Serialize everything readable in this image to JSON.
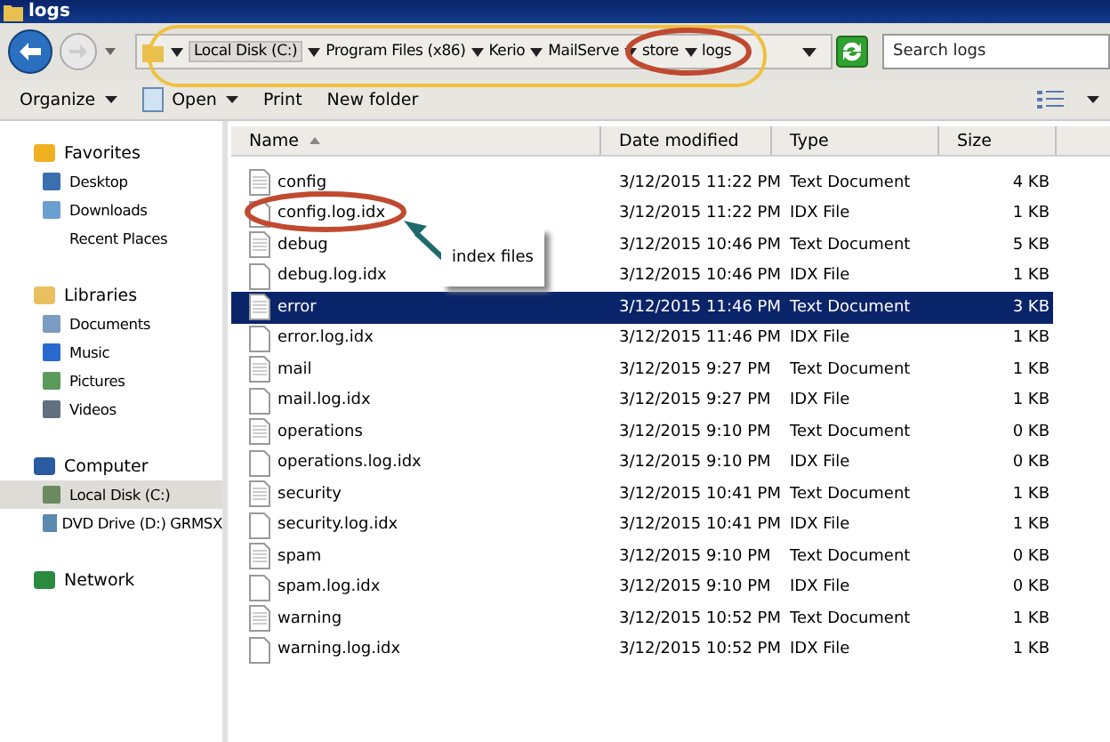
{
  "window": {
    "title": "logs"
  },
  "address": {
    "crumbs": [
      "Local Disk (C:)",
      "Program Files (x86)",
      "Kerio",
      "MailServe",
      "store",
      "logs"
    ]
  },
  "search": {
    "placeholder": "Search logs"
  },
  "toolbar": [
    {
      "label": "Organize",
      "kind": "menu"
    },
    {
      "label": "Open",
      "kind": "open"
    },
    {
      "label": "Print",
      "kind": "plain"
    },
    {
      "label": "New folder",
      "kind": "plain"
    }
  ],
  "sidebar": {
    "groups": [
      {
        "label": "Favorites",
        "items": [
          {
            "label": "Desktop",
            "selected": false
          },
          {
            "label": "Downloads",
            "selected": false
          },
          {
            "label": "Recent Places",
            "selected": false
          }
        ]
      },
      {
        "label": "Libraries",
        "items": [
          {
            "label": "Documents",
            "selected": false
          },
          {
            "label": "Music",
            "selected": false
          },
          {
            "label": "Pictures",
            "selected": false
          },
          {
            "label": "Videos",
            "selected": false
          }
        ]
      },
      {
        "label": "Computer",
        "items": [
          {
            "label": "Local Disk (C:)",
            "selected": true
          },
          {
            "label": "DVD Drive (D:) GRMSX",
            "selected": false
          }
        ]
      },
      {
        "label": "Network"
      }
    ]
  },
  "table": {
    "columns": [
      "Name",
      "Date modified",
      "Type",
      "Size"
    ],
    "rows": [
      {
        "name": "config",
        "date": "3/12/2015 11:22 PM",
        "type": "Text Document",
        "size": "4 KB",
        "kind": "text",
        "selected": false
      },
      {
        "name": "config.log.idx",
        "date": "3/12/2015 11:22 PM",
        "type": "IDX File",
        "size": "1 KB",
        "kind": "idx",
        "selected": false
      },
      {
        "name": "debug",
        "date": "3/12/2015 10:46 PM",
        "type": "Text Document",
        "size": "5 KB",
        "kind": "text",
        "selected": false
      },
      {
        "name": "debug.log.idx",
        "date": "3/12/2015 10:46 PM",
        "type": "IDX File",
        "size": "1 KB",
        "kind": "idx",
        "selected": false
      },
      {
        "name": "error",
        "date": "3/12/2015 11:46 PM",
        "type": "Text Document",
        "size": "3 KB",
        "kind": "text",
        "selected": true
      },
      {
        "name": "error.log.idx",
        "date": "3/12/2015 11:46 PM",
        "type": "IDX File",
        "size": "1 KB",
        "kind": "idx",
        "selected": false
      },
      {
        "name": "mail",
        "date": "3/12/2015 9:27 PM",
        "type": "Text Document",
        "size": "1 KB",
        "kind": "text",
        "selected": false
      },
      {
        "name": "mail.log.idx",
        "date": "3/12/2015 9:27 PM",
        "type": "IDX File",
        "size": "1 KB",
        "kind": "idx",
        "selected": false
      },
      {
        "name": "operations",
        "date": "3/12/2015 9:10 PM",
        "type": "Text Document",
        "size": "0 KB",
        "kind": "text",
        "selected": false
      },
      {
        "name": "operations.log.idx",
        "date": "3/12/2015 9:10 PM",
        "type": "IDX File",
        "size": "0 KB",
        "kind": "idx",
        "selected": false
      },
      {
        "name": "security",
        "date": "3/12/2015 10:41 PM",
        "type": "Text Document",
        "size": "1 KB",
        "kind": "text",
        "selected": false
      },
      {
        "name": "security.log.idx",
        "date": "3/12/2015 10:41 PM",
        "type": "IDX File",
        "size": "1 KB",
        "kind": "idx",
        "selected": false
      },
      {
        "name": "spam",
        "date": "3/12/2015 9:10 PM",
        "type": "Text Document",
        "size": "0 KB",
        "kind": "text",
        "selected": false
      },
      {
        "name": "spam.log.idx",
        "date": "3/12/2015 9:10 PM",
        "type": "IDX File",
        "size": "0 KB",
        "kind": "idx",
        "selected": false
      },
      {
        "name": "warning",
        "date": "3/12/2015 10:52 PM",
        "type": "Text Document",
        "size": "1 KB",
        "kind": "text",
        "selected": false
      },
      {
        "name": "warning.log.idx",
        "date": "3/12/2015 10:52 PM",
        "type": "IDX File",
        "size": "1 KB",
        "kind": "idx",
        "selected": false
      }
    ]
  },
  "annotation": {
    "callout": "index files"
  }
}
